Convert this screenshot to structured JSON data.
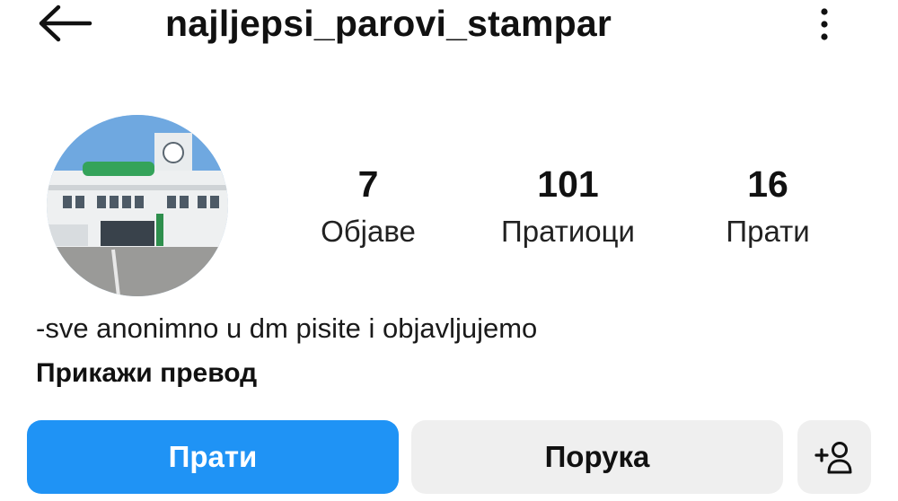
{
  "header": {
    "username": "najljepsi_parovi_stampar",
    "back_icon": "arrow-left-icon",
    "more_icon": "vertical-dots-icon"
  },
  "profile": {
    "avatar_description": "school-building-photo"
  },
  "stats": {
    "posts": {
      "value": "7",
      "label": "Објаве"
    },
    "followers": {
      "value": "101",
      "label": "Пратиоци"
    },
    "following": {
      "value": "16",
      "label": "Прати"
    }
  },
  "bio": {
    "text": "-sve anonimno u dm pisite i objavljujemo",
    "translate_label": "Прикажи превод"
  },
  "actions": {
    "follow_label": "Прати",
    "message_label": "Порука",
    "add_user_icon": "add-person-icon"
  },
  "colors": {
    "accent": "#1f93f5",
    "secondary_button": "#efefef",
    "text": "#111111"
  }
}
